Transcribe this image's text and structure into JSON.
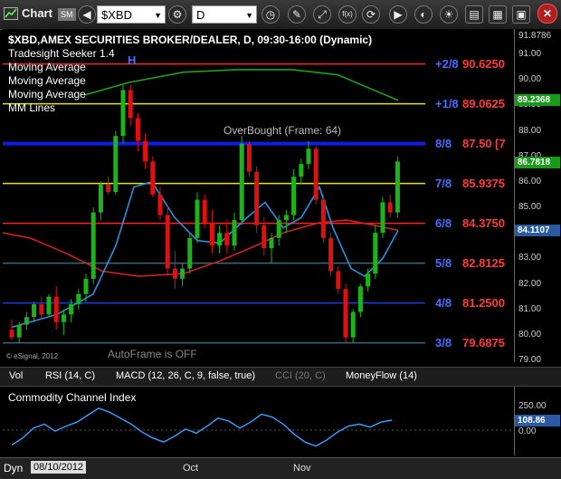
{
  "toolbar": {
    "app_title": "Chart",
    "app_badge": "SM",
    "symbol": "$XBD",
    "interval": "D"
  },
  "chart": {
    "header": "$XBD,AMEX SECURITIES BROKER/DEALER, D, 09:30-16:00 (Dynamic)",
    "studies": [
      "Tradesight Seeker 1.4",
      "Moving Average",
      "Moving Average",
      "Moving Average",
      "MM Lines"
    ],
    "overbought_label": "OverBought (Frame: 64)",
    "autoframe_label": "AutoFrame is OFF",
    "copyright": "© eSignal, 2012",
    "seeker_marker": "H",
    "mm_lines": [
      {
        "label": "+2/8",
        "price": "90.6250",
        "value": 90.625,
        "label_color": "#4a6cff",
        "price_color": "#ff3b3b",
        "line_color": "#ff2020"
      },
      {
        "label": "+1/8",
        "price": "89.0625",
        "value": 89.0625,
        "label_color": "#4a6cff",
        "price_color": "#ff3b3b",
        "line_color": "#e6e600"
      },
      {
        "label": "8/8",
        "price": "87.50",
        "suffix": "[7",
        "value": 87.5,
        "label_color": "#4a6cff",
        "price_color": "#ff3b3b",
        "line_color": "#0a1ee6"
      },
      {
        "label": "7/8",
        "price": "85.9375",
        "value": 85.9375,
        "label_color": "#4a6cff",
        "price_color": "#ff3b3b",
        "line_color": "#e6e600"
      },
      {
        "label": "6/8",
        "price": "84.3750",
        "value": 84.375,
        "label_color": "#4a6cff",
        "price_color": "#ff3b3b",
        "line_color": "#ff2020"
      },
      {
        "label": "5/8",
        "price": "82.8125",
        "value": 82.8125,
        "label_color": "#4a6cff",
        "price_color": "#ff3b3b",
        "line_color": "#3a6a7a"
      },
      {
        "label": "4/8",
        "price": "81.2500",
        "value": 81.25,
        "label_color": "#4a6cff",
        "price_color": "#ff3b3b",
        "line_color": "#1a3ae6"
      },
      {
        "label": "3/8",
        "price": "79.6875",
        "value": 79.6875,
        "label_color": "#4a6cff",
        "price_color": "#ff3b3b",
        "line_color": "#3a6a7a"
      }
    ],
    "colors": {
      "up": "#1db31d",
      "down": "#e01010",
      "ma_green": "#20a020",
      "ma_red": "#d02020",
      "ma_blue": "#2a90e0"
    }
  },
  "y_axis": {
    "top_label": "91.8786",
    "ticks": [
      "91.00",
      "90.00",
      "89.00",
      "88.00",
      "87.00",
      "86.00",
      "85.00",
      "84.00",
      "83.00",
      "82.00",
      "81.00",
      "80.00",
      "79.00"
    ],
    "badges": [
      {
        "text": "89.2368",
        "value": 89.2368,
        "bg": "#1a9a1a",
        "fg": "#ffffff"
      },
      {
        "text": "86.7818",
        "value": 86.7818,
        "bg": "#1a9a1a",
        "fg": "#ffffff"
      },
      {
        "text": "84.1107",
        "value": 84.1107,
        "bg": "#2a5aa0",
        "fg": "#ffffff"
      }
    ]
  },
  "tabs": [
    "Vol",
    "RSI (14, C)",
    "MACD (12, 26, C, 9, false, true)",
    "CCI (20, C)",
    "MoneyFlow (14)"
  ],
  "cci": {
    "label": "Commodity Channel Index",
    "ticks": [
      "250.00",
      "0.00"
    ],
    "badge": "108.86"
  },
  "bottom_bar": {
    "dyn_label": "Dyn",
    "date": "08/10/2012",
    "x_labels": [
      "Oct",
      "Nov"
    ]
  }
}
